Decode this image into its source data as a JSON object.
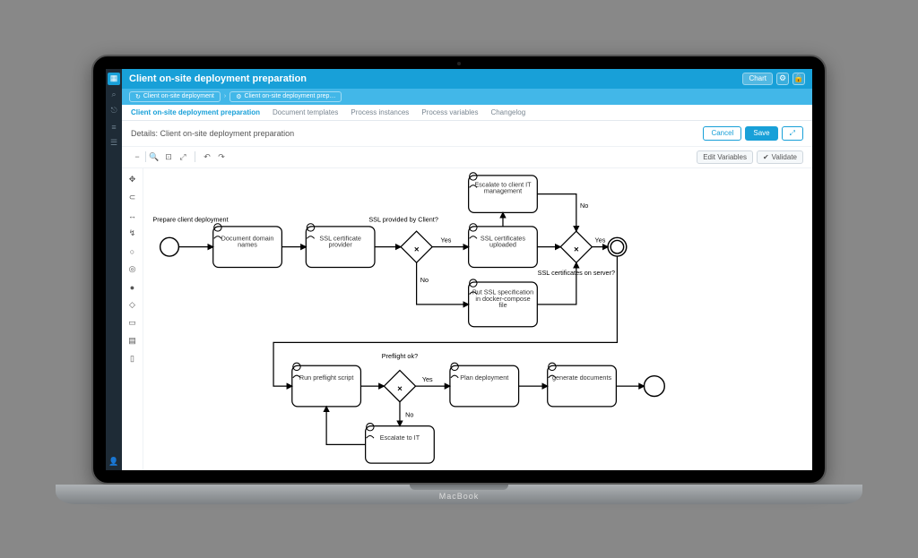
{
  "header": {
    "title": "Client on-site deployment preparation",
    "chart_btn": "Chart"
  },
  "breadcrumbs": {
    "item1": "Client on-site deployment",
    "item2": "Client on-site deployment prep…"
  },
  "tabs": {
    "t1": "Client on-site deployment preparation",
    "t2": "Document templates",
    "t3": "Process instances",
    "t4": "Process variables",
    "t5": "Changelog"
  },
  "details": {
    "label": "Details: Client on-site deployment preparation",
    "cancel": "Cancel",
    "save": "Save"
  },
  "toolbar": {
    "edit_vars": "Edit Variables",
    "validate": "Validate"
  },
  "diagram": {
    "start_label": "Prepare client deployment",
    "task_domain": "Document domain names",
    "task_ssl_provider": "SSL certificate provider",
    "gw_ssl_client": "SSL provided by Client?",
    "task_ssl_uploaded": "SSL certificates uploaded",
    "task_escalate_client": "Escalate to client IT management",
    "task_docker": "Put SSL specification in docker-compose file",
    "gw_ssl_server": "SSL certificates on server?",
    "task_preflight": "Run preflight script",
    "gw_preflight": "Preflight ok?",
    "task_escalate_it": "Escalate to IT",
    "task_plan": "Plan deployment",
    "task_gen_docs": "generate documents",
    "yes": "Yes",
    "no": "No"
  },
  "macbook": "MacBook"
}
